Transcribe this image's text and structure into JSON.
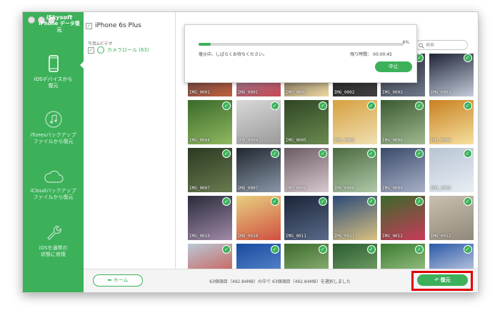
{
  "sidebar": {
    "brand": "iSkysoft",
    "product": "iPhone データ復元",
    "items": [
      {
        "label_line1": "iOSデバイスから",
        "label_line2": "復元",
        "icon": "iphone-icon",
        "active": true
      },
      {
        "label_line1": "iTunesバックアップ",
        "label_line2": "ファイルから復元",
        "icon": "music-note-icon",
        "active": false
      },
      {
        "label_line1": "iCloudバックアップ",
        "label_line2": "ファイルから復元",
        "icon": "cloud-icon",
        "active": false
      },
      {
        "label_line1": "iOSを通常の",
        "label_line2": "状態に修復",
        "icon": "wrench-icon",
        "active": false
      }
    ]
  },
  "tree": {
    "device": "iPhone 6s Plus",
    "category": "写真&ビデオ",
    "item": "カメラロール (63)"
  },
  "search": {
    "placeholder": "検索"
  },
  "progress": {
    "percent": 6,
    "percent_label": "6%",
    "message": "復元中、しばらくお待ちください。",
    "remaining": "残り時間： 00:00:45",
    "stop_label": "中止"
  },
  "photos": [
    {
      "label": "IMG_0001",
      "colors": [
        "#2a3050",
        "#c0603a"
      ]
    },
    {
      "label": "IMG_0001",
      "colors": [
        "#6e8fb6",
        "#c84a52"
      ]
    },
    {
      "label": "IMG_0002",
      "colors": [
        "#1f2228",
        "#f0d8a0"
      ]
    },
    {
      "label": "IMG_0002",
      "colors": [
        "#121212",
        "#404040"
      ]
    },
    {
      "label": "IMG_0003",
      "colors": [
        "#20252f",
        "#70788a"
      ]
    },
    {
      "label": "IMG_0003",
      "colors": [
        "#1a2030",
        "#c4ccdc"
      ]
    },
    {
      "label": "IMG_0004",
      "colors": [
        "#3a6a2a",
        "#8fb860"
      ]
    },
    {
      "label": "IMG_0004",
      "colors": [
        "#d8d8d8",
        "#9a9a9a"
      ]
    },
    {
      "label": "IMG_0005",
      "colors": [
        "#2f4524",
        "#6a8a50"
      ]
    },
    {
      "label": "IMG_0005",
      "colors": [
        "#d6a040",
        "#f0e0b0"
      ]
    },
    {
      "label": "IMG_0006",
      "colors": [
        "#3a5a30",
        "#a0b890"
      ]
    },
    {
      "label": "IMG_0006",
      "colors": [
        "#c88020",
        "#f6e0a0"
      ]
    },
    {
      "label": "IMG_0007",
      "colors": [
        "#2a3a20",
        "#6a7a50"
      ]
    },
    {
      "label": "IMG_0007",
      "colors": [
        "#202830",
        "#8a96a8"
      ]
    },
    {
      "label": "IMG_0008",
      "colors": [
        "#6a5a62",
        "#d8c8d0"
      ]
    },
    {
      "label": "IMG_0008",
      "colors": [
        "#4a6a40",
        "#b0c8a8"
      ]
    },
    {
      "label": "IMG_0009",
      "colors": [
        "#3a4a6a",
        "#a8b0c8"
      ]
    },
    {
      "label": "IMG_0009",
      "colors": [
        "#b8c4d4",
        "#e8eef4"
      ]
    },
    {
      "label": "IMG_0010",
      "colors": [
        "#2a2a3a",
        "#a08aa8"
      ]
    },
    {
      "label": "IMG_0010",
      "colors": [
        "#e8d080",
        "#d05040"
      ]
    },
    {
      "label": "IMG_0011",
      "colors": [
        "#1a2438",
        "#5a6a88"
      ]
    },
    {
      "label": "IMG_0011",
      "colors": [
        "#2a4a78",
        "#d8c080"
      ]
    },
    {
      "label": "IMG_0012",
      "colors": [
        "#3a6a2a",
        "#c83a5a"
      ]
    },
    {
      "label": "IMG_0012",
      "colors": [
        "#c8c0b0",
        "#908878"
      ]
    },
    {
      "label": "",
      "colors": [
        "#b8c8d8",
        "#d04030"
      ]
    },
    {
      "label": "",
      "colors": [
        "#1a4aa0",
        "#6a98d8"
      ]
    },
    {
      "label": "",
      "colors": [
        "#3a6a2a",
        "#a8c890"
      ]
    },
    {
      "label": "",
      "colors": [
        "#2a5a30",
        "#8ab878"
      ]
    },
    {
      "label": "",
      "colors": [
        "#3a7a30",
        "#b8d8a0"
      ]
    },
    {
      "label": "",
      "colors": [
        "#2a58a8",
        "#f0f0f0"
      ]
    }
  ],
  "footer": {
    "home_label": "ホーム",
    "status": "63個項目（492.84MB）の中で 63個項目（492.84MB）を選択しました",
    "recover_label": "復元"
  }
}
